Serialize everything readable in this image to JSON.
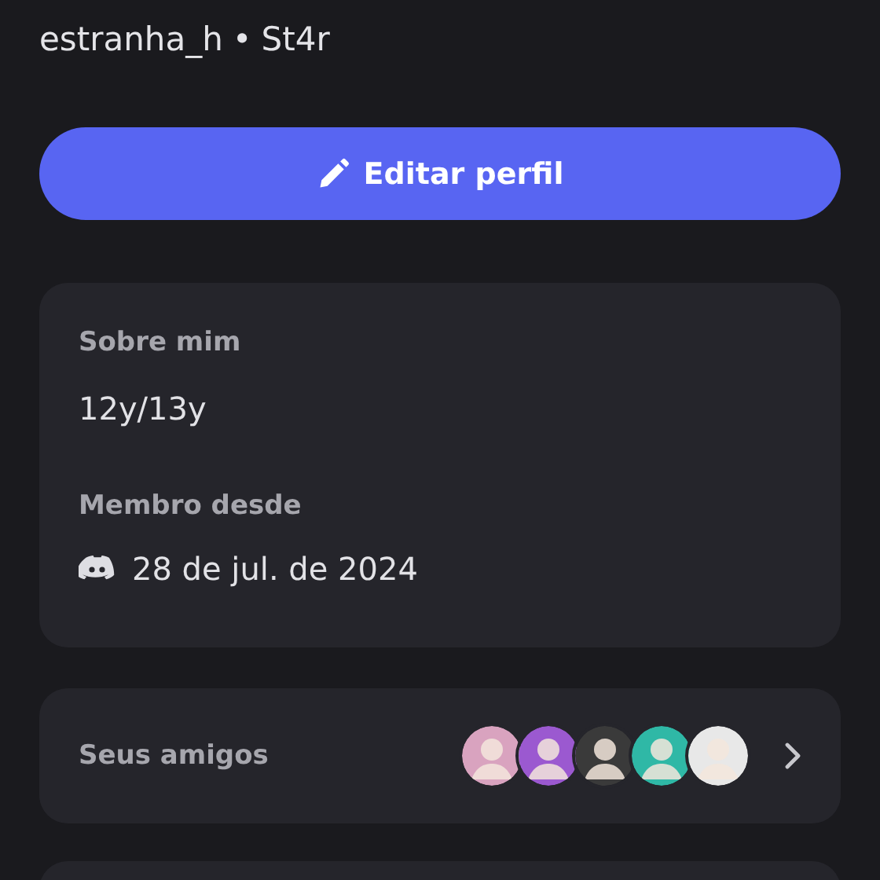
{
  "profile": {
    "username": "estranha_h",
    "separator": "•",
    "tag": "St4r"
  },
  "edit_button": {
    "label": "Editar perfil"
  },
  "about": {
    "heading": "Sobre mim",
    "text": "12y/13y",
    "member_heading": "Membro desde",
    "member_since": "28 de jul. de 2024"
  },
  "friends": {
    "label": "Seus amigos",
    "avatars": [
      {
        "color": "#d9a3bf"
      },
      {
        "color": "#9b59d0"
      },
      {
        "color": "#3a3a3a"
      },
      {
        "color": "#2fb8a6"
      },
      {
        "color": "#e8e8e8"
      }
    ]
  }
}
